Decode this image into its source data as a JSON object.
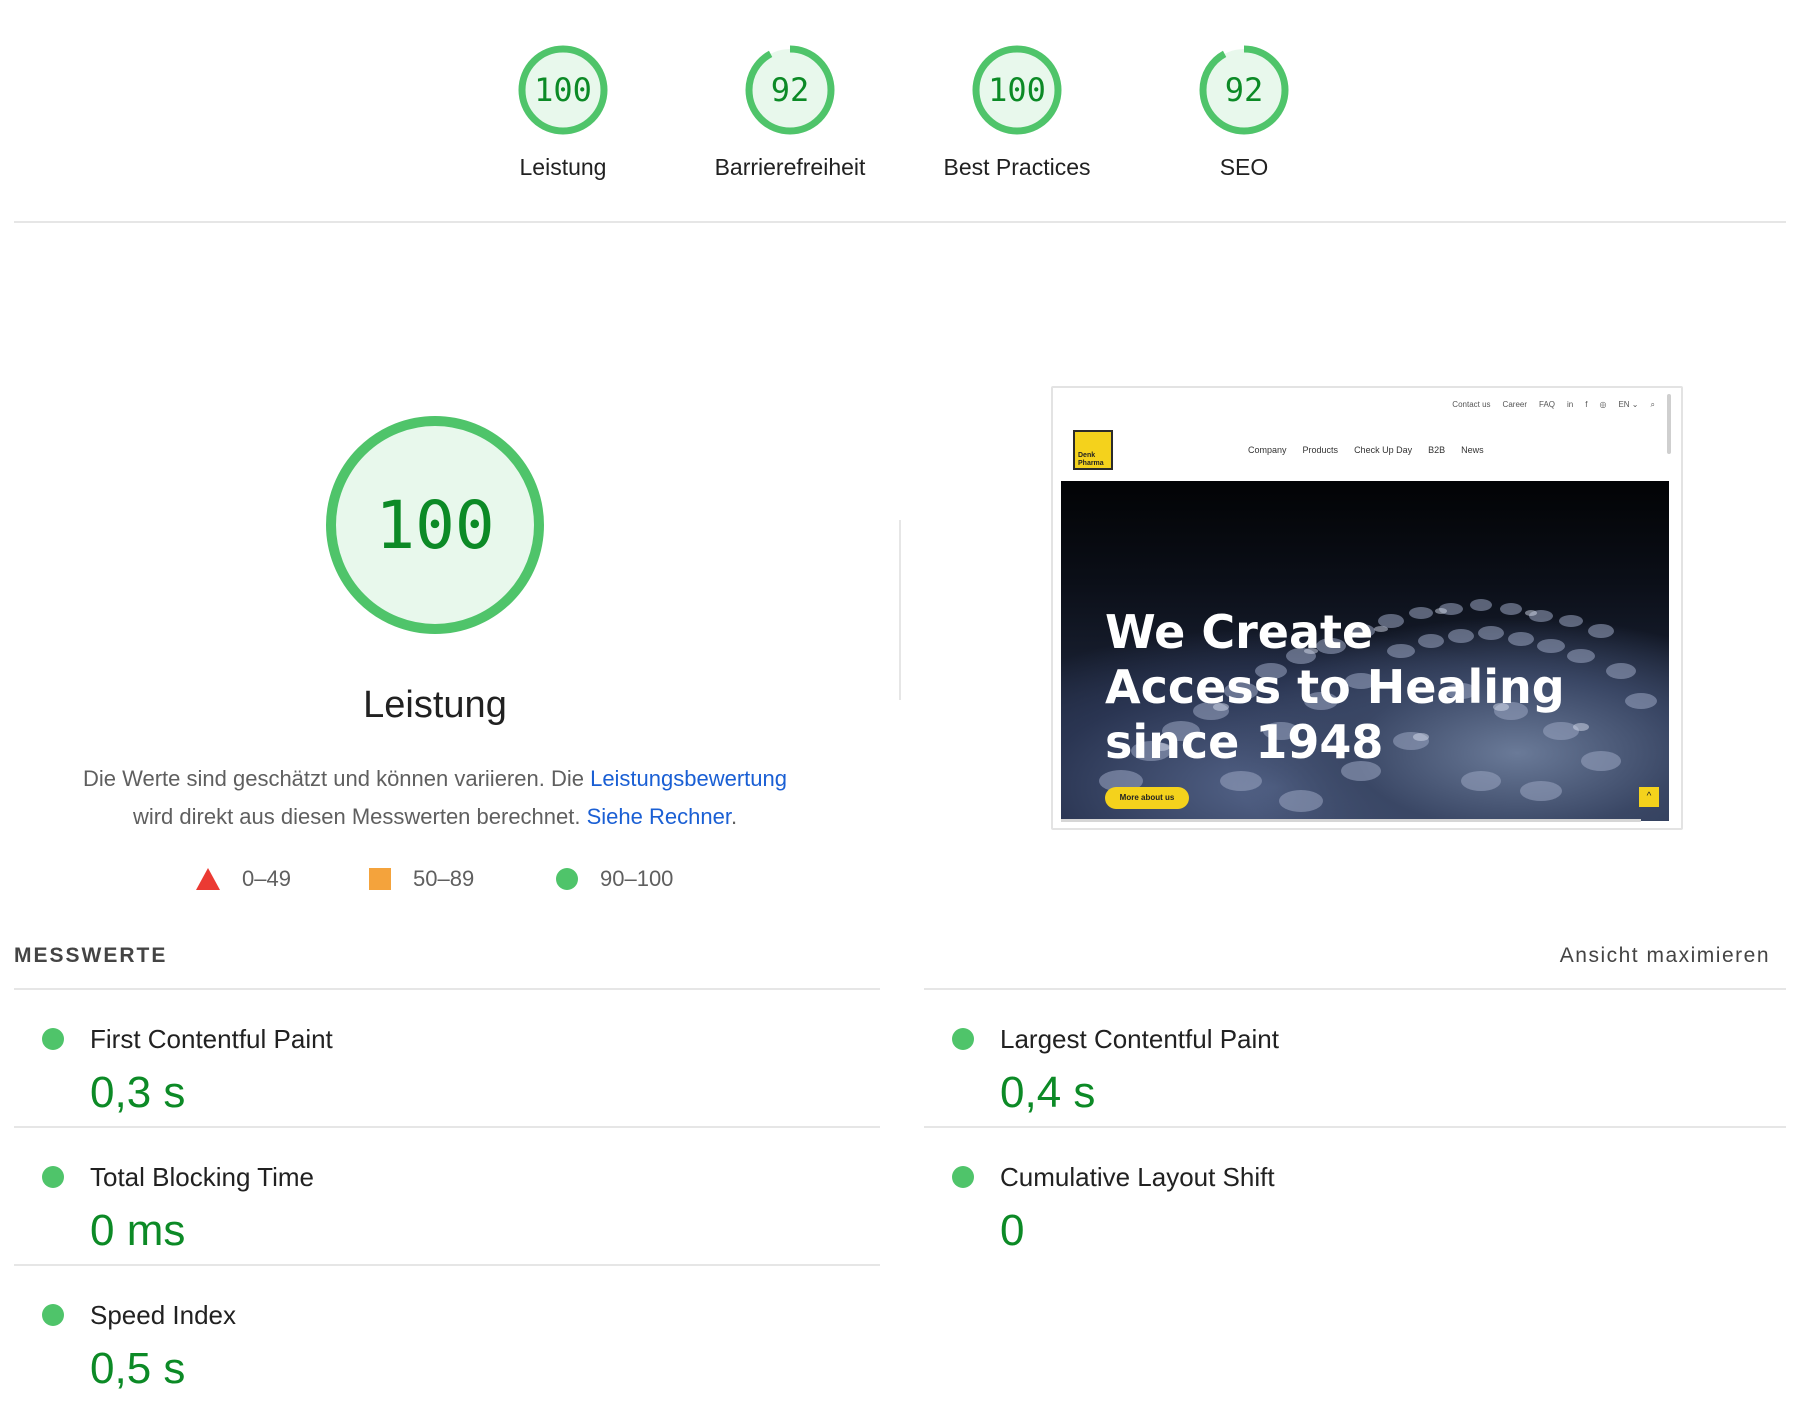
{
  "scores": [
    {
      "value": "100",
      "label": "Leistung",
      "score": 100
    },
    {
      "value": "92",
      "label": "Barrierefreiheit",
      "score": 92
    },
    {
      "value": "100",
      "label": "Best Practices",
      "score": 100
    },
    {
      "value": "92",
      "label": "SEO",
      "score": 92
    }
  ],
  "performance": {
    "score_text": "100",
    "score": 100,
    "title": "Leistung",
    "desc_part1": "Die Werte sind geschätzt und können variieren. Die ",
    "desc_link1": "Leistungsbewertung",
    "desc_part2": " wird direkt aus diesen Messwerten berechnet. ",
    "desc_link2": "Siehe Rechner",
    "desc_part3": "."
  },
  "legend": [
    {
      "range": "0–49",
      "color": "#eb3a33",
      "shape": "triangle"
    },
    {
      "range": "50–89",
      "color": "#f4a33c",
      "shape": "square"
    },
    {
      "range": "90–100",
      "color": "#4fc46a",
      "shape": "circle"
    }
  ],
  "thumbnail": {
    "top_nav": [
      "Contact us",
      "Career",
      "FAQ",
      "in",
      "f",
      "◎",
      "EN ⌄",
      "⌕"
    ],
    "logo_text": "Denk Pharma",
    "main_nav": [
      "Company",
      "Products",
      "Check Up Day",
      "B2B",
      "News"
    ],
    "headline_lines": [
      "We Create",
      "Access to Healing",
      "since 1948"
    ],
    "cta": "More about us",
    "up_icon": "^"
  },
  "metrics_section": {
    "header": "MESSWERTE",
    "toggle": "Ansicht maximieren"
  },
  "metrics": [
    {
      "name": "First Contentful Paint",
      "value": "0,3 s"
    },
    {
      "name": "Largest Contentful Paint",
      "value": "0,4 s"
    },
    {
      "name": "Total Blocking Time",
      "value": "0 ms"
    },
    {
      "name": "Cumulative Layout Shift",
      "value": "0"
    },
    {
      "name": "Speed Index",
      "value": "0,5 s"
    }
  ],
  "colors": {
    "pass": "#0c8a26",
    "pass_ring": "#4fc46a",
    "pass_fill": "#e8f8ec",
    "link": "#1a5fd4"
  }
}
